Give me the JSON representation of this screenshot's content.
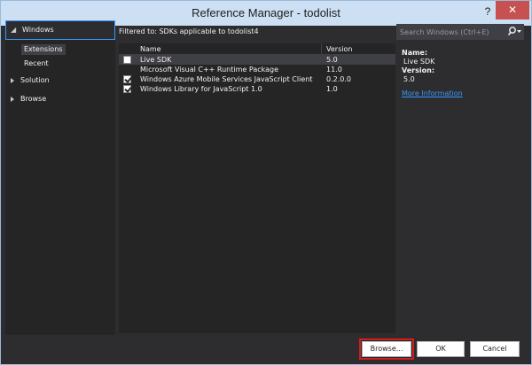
{
  "window": {
    "title": "Reference Manager - todolist",
    "help_label": "?",
    "close_label": "✕"
  },
  "nav": {
    "windows": {
      "label": "Windows",
      "expanded": true
    },
    "windows_children": [
      "Extensions",
      "Recent"
    ],
    "selected_child": "Extensions",
    "solution": {
      "label": "Solution",
      "expanded": false
    },
    "browse": {
      "label": "Browse",
      "expanded": false
    }
  },
  "filter": {
    "text": "Filtered to: SDKs applicable to todolist4"
  },
  "search": {
    "placeholder": "Search Windows (Ctrl+E)",
    "value": "",
    "icon": "search-icon"
  },
  "list": {
    "headers": {
      "name": "Name",
      "version": "Version"
    },
    "rows": [
      {
        "name": "Live SDK",
        "version": "5.0",
        "checkbox": true,
        "checked": false,
        "selected": true
      },
      {
        "name": "Microsoft Visual C++ Runtime Package",
        "version": "11.0",
        "checkbox": false,
        "checked": false,
        "selected": false
      },
      {
        "name": "Windows Azure Mobile Services JavaScript Client",
        "version": "0.2.0.0",
        "checkbox": true,
        "checked": true,
        "selected": false
      },
      {
        "name": "Windows Library for JavaScript 1.0",
        "version": "1.0",
        "checkbox": true,
        "checked": true,
        "selected": false
      }
    ]
  },
  "details": {
    "name_label": "Name:",
    "name_value": "Live SDK",
    "version_label": "Version:",
    "version_value": "5.0",
    "link": "More Information"
  },
  "buttons": {
    "browse": "Browse...",
    "ok": "OK",
    "cancel": "Cancel"
  },
  "colors": {
    "background": "#2d2d30",
    "titlebar": "#ccdff3",
    "accent": "#3399ff",
    "close": "#c75050",
    "highlight_border": "#d41c1c"
  }
}
